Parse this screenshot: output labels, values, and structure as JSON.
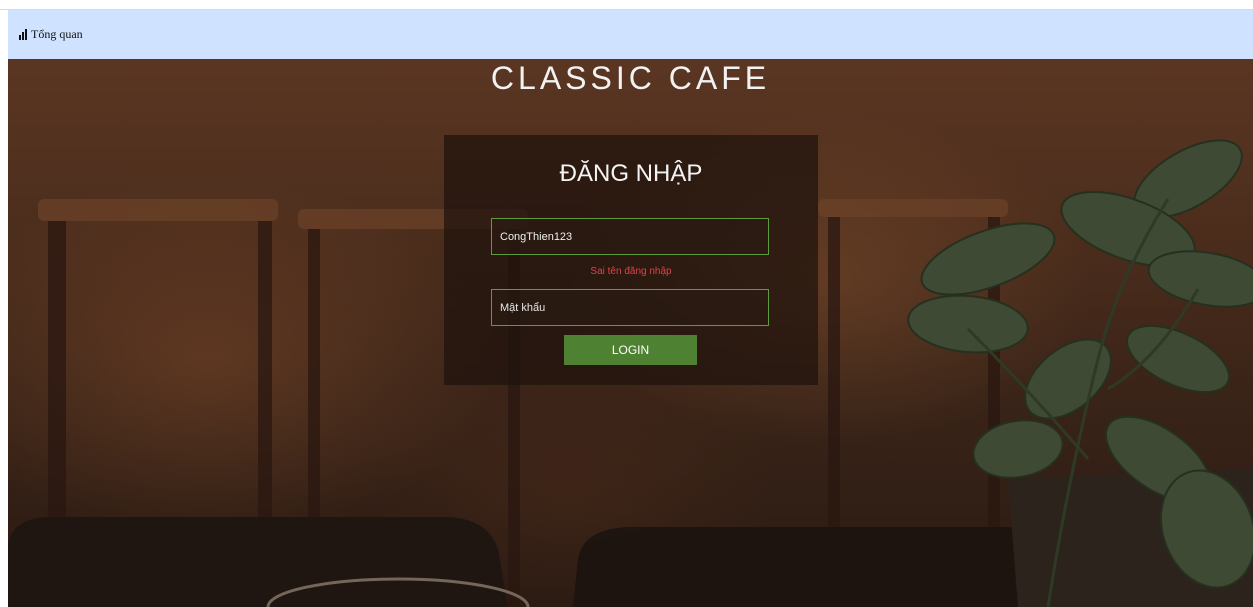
{
  "navbar": {
    "link_label": "Tổng quan",
    "icon": "bar-chart-icon",
    "background": "#cfe2ff"
  },
  "brand": {
    "title": "CLASSIC CAFE"
  },
  "login": {
    "title": "ĐĂNG NHẬP",
    "username_value": "CongThien123",
    "password_placeholder": "Mật khẩu",
    "error_message": "Sai tên đăng nhập",
    "button_label": "LOGIN",
    "accent_color": "#4e8232",
    "error_color": "#e0414a"
  }
}
